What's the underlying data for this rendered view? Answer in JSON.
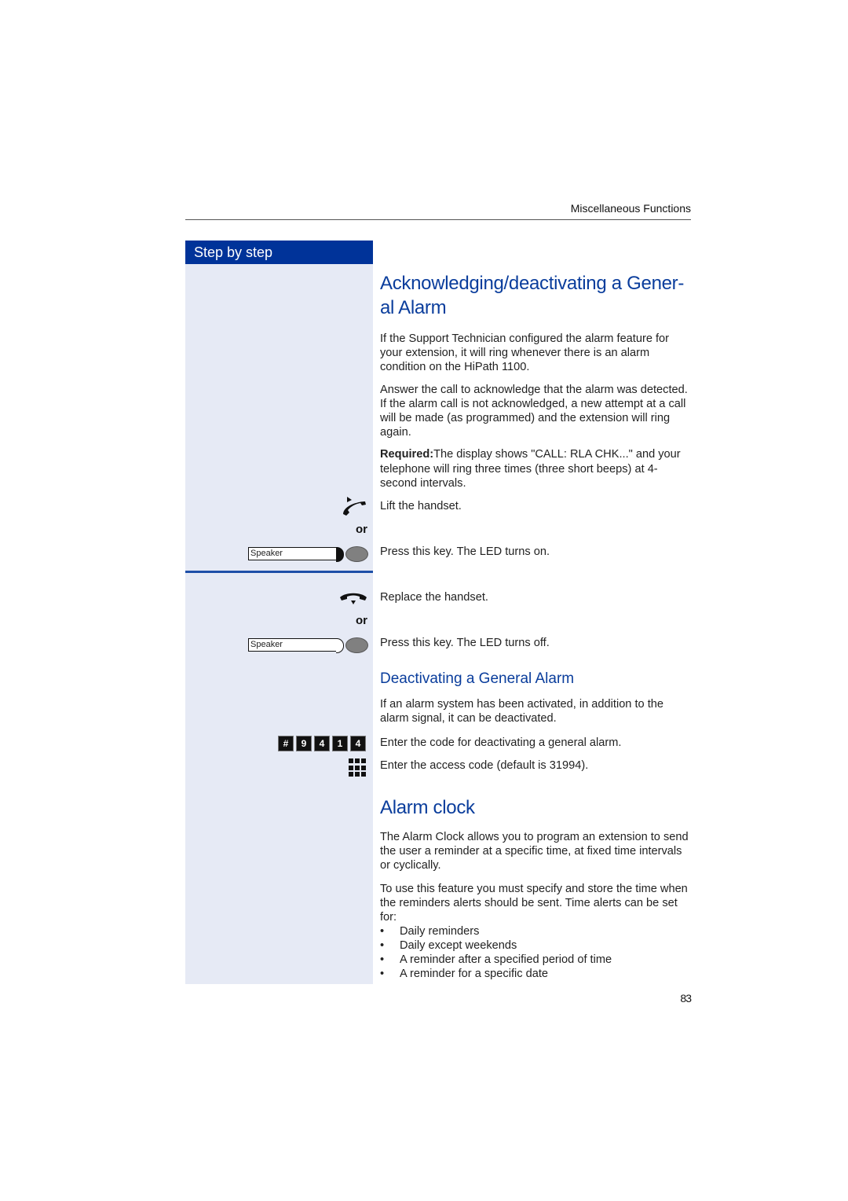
{
  "header": {
    "section_title": "Miscellaneous Functions"
  },
  "sidebar": {
    "title": "Step by step"
  },
  "section1": {
    "title": "Acknowledging/deactivating a Gener-al Alarm",
    "title_line1": "Acknowledging/deactivating a Gener-",
    "title_line2": "al Alarm",
    "paragraphs": [
      "If the Support Technician configured the alarm feature for your extension, it will ring whenever there is an alarm condition on the HiPath 1100.",
      "Answer the call to acknowledge that the alarm was detected. If the alarm call is not acknowledged, a new attempt at a call will be made (as programmed) and the extension will ring again."
    ],
    "required_label": "Required:",
    "required_text": "The display shows \"CALL: RLA CHK...\" and your telephone will ring three times (three short beeps) at 4-second intervals."
  },
  "steps": [
    {
      "icon": "lift-handset-icon",
      "text": "Lift the handset."
    },
    {
      "icon": "speaker-key-led-on",
      "key_label": "Speaker",
      "text": "Press this key. The LED turns on."
    },
    {
      "icon": "replace-handset-icon",
      "text": "Replace the handset."
    },
    {
      "icon": "speaker-key-led-off",
      "key_label": "Speaker",
      "text": "Press this key. The LED turns off."
    }
  ],
  "or_label": "or",
  "section2": {
    "title": "Deactivating a General Alarm",
    "paragraph": "If an alarm system has been activated, in addition to the alarm signal, it can be deactivated.",
    "code_keys": [
      "#",
      "9",
      "4",
      "1",
      "4"
    ],
    "code_step_text": "Enter the code for deactivating a general alarm.",
    "keypad_step_text": "Enter the access code (default is 31994)."
  },
  "section3": {
    "title": "Alarm clock",
    "paragraphs": [
      "The Alarm Clock allows you to program an extension to send the user a reminder at a specific time, at fixed time intervals or cyclically.",
      "To use this feature you must specify and store the time when the reminders alerts should be sent. Time alerts can be set for:"
    ],
    "bullets": [
      "Daily reminders",
      "Daily except weekends",
      "A reminder after a specified period of time",
      "A reminder for a specific date"
    ]
  },
  "footer": {
    "page_number": "83"
  },
  "colors": {
    "accent": "#003399",
    "heading": "#0a3d9c",
    "sidebar_bg": "#e6eaf5"
  }
}
